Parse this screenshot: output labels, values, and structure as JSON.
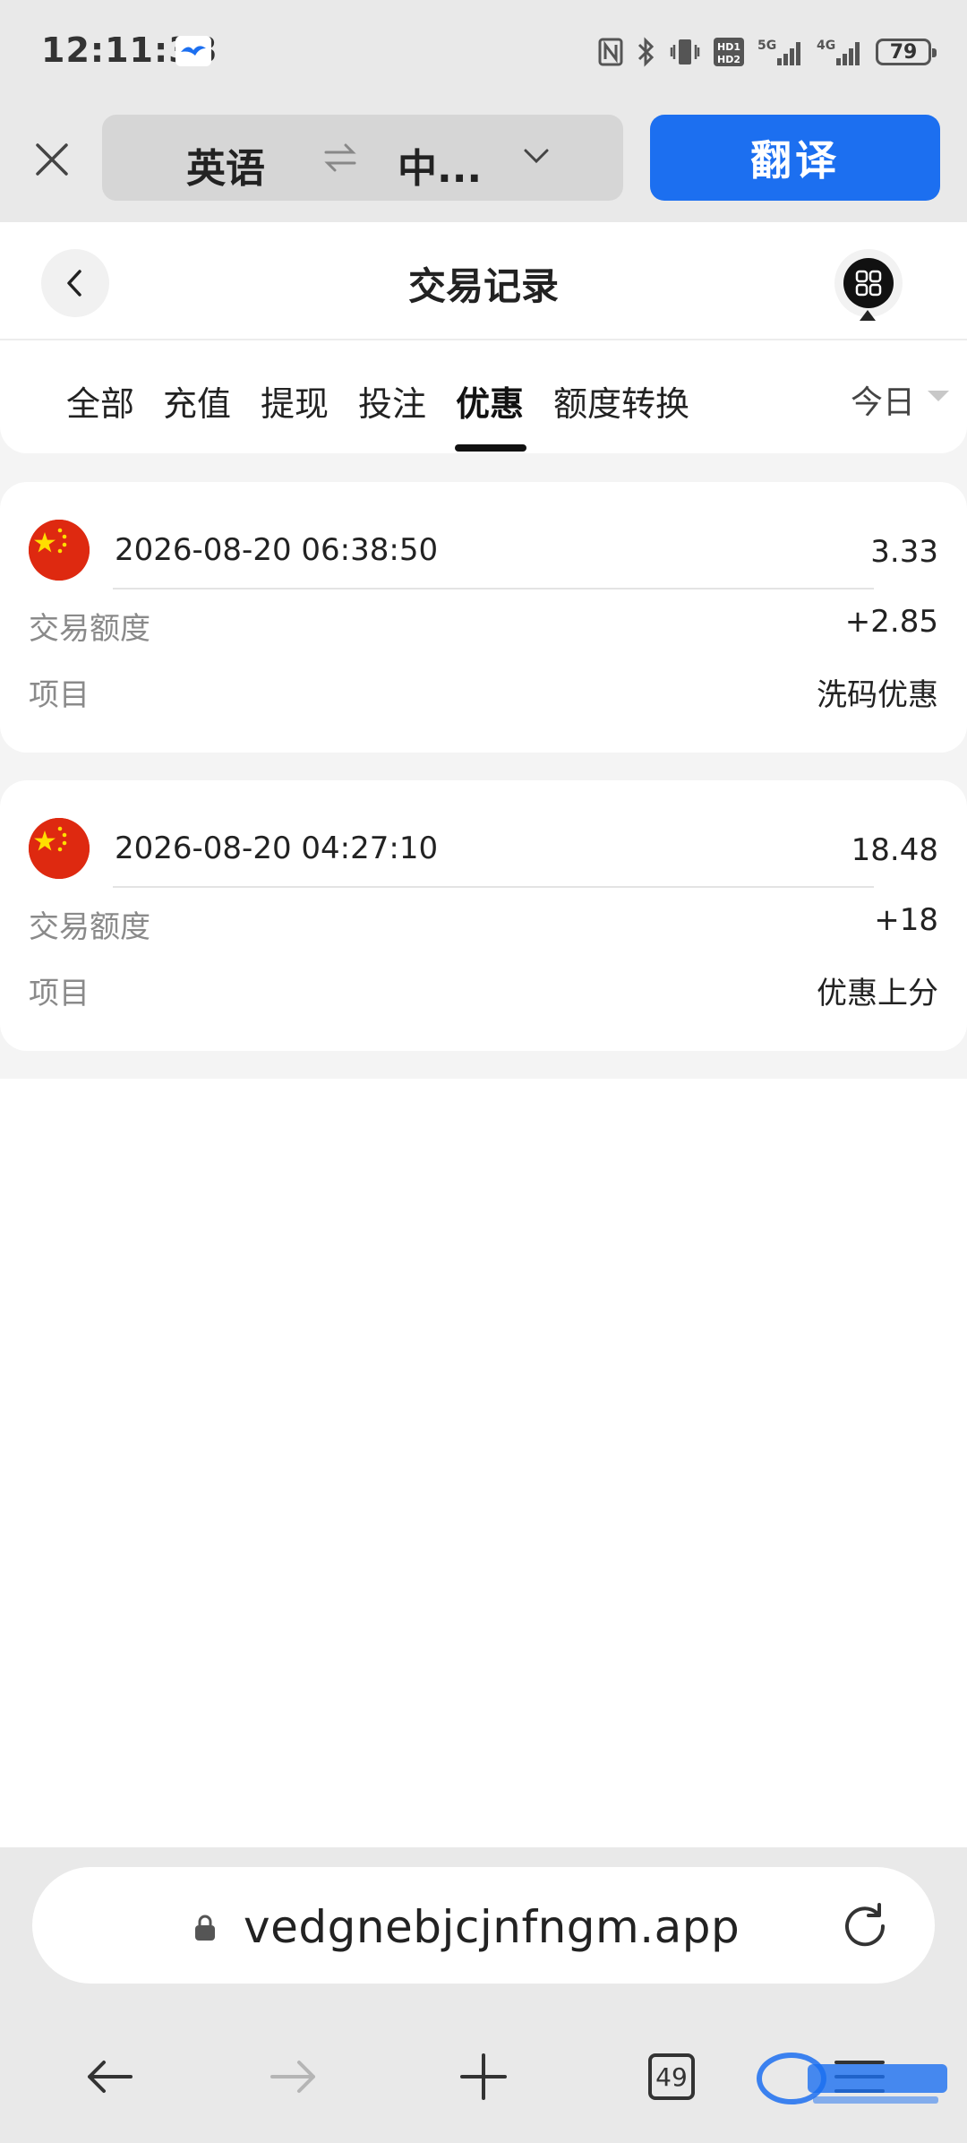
{
  "status_bar": {
    "time": "12:11:38",
    "battery": "79",
    "icons": [
      "nfc-icon",
      "bluetooth-icon",
      "vibrate-icon",
      "hd-icon",
      "5g-signal-icon",
      "4g-signal-icon",
      "battery-icon"
    ]
  },
  "translate_bar": {
    "source_lang": "英语",
    "target_lang": "中...",
    "translate_button": "翻译"
  },
  "header": {
    "title": "交易记录"
  },
  "tabs": [
    {
      "label": "全部"
    },
    {
      "label": "充值"
    },
    {
      "label": "提现"
    },
    {
      "label": "投注"
    },
    {
      "label": "优惠",
      "active": true
    },
    {
      "label": "额度转换"
    }
  ],
  "date_filter": "今日",
  "records": [
    {
      "time": "2026-08-20 06:38:50",
      "amount": "3.33",
      "label1": "交易额度",
      "value1": "+2.85",
      "label2": "项目",
      "value2": "洗码优惠"
    },
    {
      "time": "2026-08-20 04:27:10",
      "amount": "18.48",
      "label1": "交易额度",
      "value1": "+18",
      "label2": "项目",
      "value2": "优惠上分"
    }
  ],
  "browser": {
    "url": "vedgnebjcjnfngm.app",
    "tab_count": "49"
  },
  "colors": {
    "accent": "#1c6ff0",
    "flag_red": "#de2910",
    "flag_yellow": "#ffde00"
  }
}
